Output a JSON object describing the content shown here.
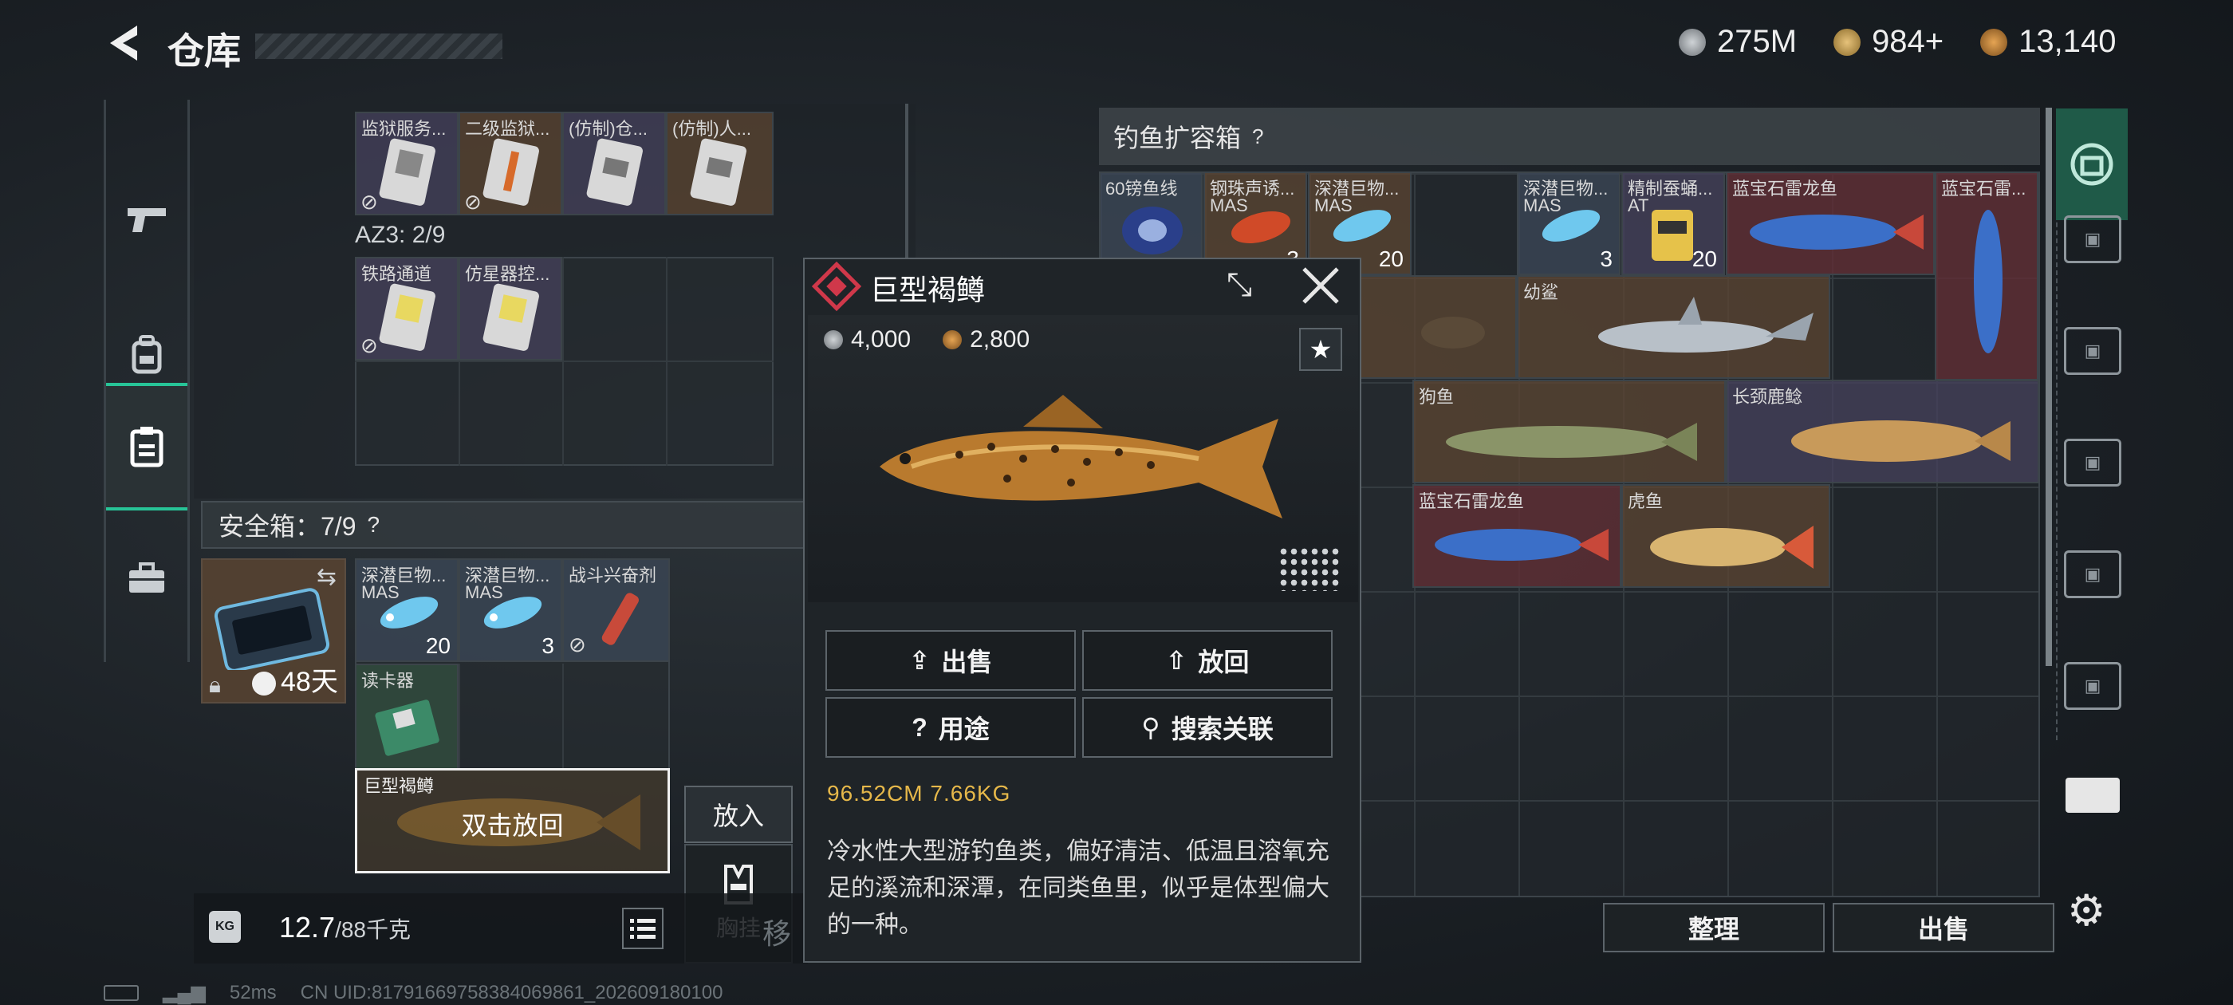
{
  "header": {
    "title": "仓库"
  },
  "currencies": [
    {
      "icon": "silver-coin-icon",
      "value": "275M",
      "color": "#9aa0a6"
    },
    {
      "icon": "triangle-token-icon",
      "value": "984+",
      "color": "#c9a35a"
    },
    {
      "icon": "gold-coin-icon",
      "value": "13,140",
      "color": "#c0883a"
    }
  ],
  "sidebar": {
    "items": [
      {
        "icon": "pistol-icon"
      },
      {
        "icon": "backpack-icon"
      },
      {
        "icon": "storage-icon",
        "active": true
      },
      {
        "icon": "briefcase-icon"
      }
    ]
  },
  "left_grid": {
    "top_items": [
      "监狱服务...",
      "二级监狱...",
      "(仿制)仓...",
      "(仿制)人..."
    ],
    "az3_label": "AZ3: 2/9",
    "az3_items": [
      "铁路通道",
      "仿星器控..."
    ]
  },
  "safe_box": {
    "label": "安全箱：7/9",
    "help": "?",
    "days": "48天",
    "items": [
      {
        "name": "深潜巨物...",
        "sub": "MAS",
        "count": "20"
      },
      {
        "name": "深潜巨物...",
        "sub": "MAS",
        "count": "3"
      },
      {
        "name": "战斗兴奋剂",
        "sub": "",
        "count": ""
      },
      {
        "name": "读卡器",
        "sub": "",
        "count": ""
      }
    ],
    "selected": {
      "name": "巨型褐鳟",
      "hint": "双击放回"
    }
  },
  "place_button": "放入",
  "chest_rig": {
    "label": "胸挂"
  },
  "weight": {
    "current": "12.7",
    "max": "/88千克"
  },
  "ghost_text": "移",
  "expansion_box": {
    "title": "钓鱼扩容箱",
    "help": "?",
    "items": [
      {
        "name": "60镑鱼线",
        "sub": "",
        "count": ""
      },
      {
        "name": "钢珠声诱...",
        "sub": "MAS",
        "count": "3"
      },
      {
        "name": "深潜巨物...",
        "sub": "MAS",
        "count": "20"
      },
      {
        "name": "深潜巨物...",
        "sub": "MAS",
        "count": "3"
      },
      {
        "name": "精制蚕蛹...",
        "sub": "AT",
        "count": "20"
      },
      {
        "name": "蓝宝石雷龙鱼",
        "sub": "",
        "count": ""
      },
      {
        "name": "蓝宝石雷...",
        "sub": "",
        "count": ""
      },
      {
        "name": "幼鲨",
        "sub": "",
        "count": ""
      },
      {
        "name": "狗鱼",
        "sub": "",
        "count": ""
      },
      {
        "name": "长颈鹿鲶",
        "sub": "",
        "count": ""
      },
      {
        "name": "蓝宝石雷龙鱼",
        "sub": "",
        "count": ""
      },
      {
        "name": "虎鱼",
        "sub": "",
        "count": ""
      }
    ],
    "sort_button": "整理",
    "sell_button": "出售"
  },
  "popup": {
    "title": "巨型褐鳟",
    "price_silver": "4,000",
    "price_gold": "2,800",
    "buttons": {
      "sell": "出售",
      "return": "放回",
      "use": "用途",
      "search": "搜索关联"
    },
    "size": "96.52CM 7.66KG",
    "description": "冷水性大型游钓鱼类，偏好清洁、低温且溶氧充足的溪流和深潭，在同类鱼里，似乎是体型偏大的一种。"
  },
  "status": {
    "ping": "52ms",
    "uid": "CN UID:817916697583840698​61_202609180100"
  },
  "colors": {
    "accent": "#27c497",
    "rarity_red": "#d0384a",
    "size_text": "#e6b84a"
  }
}
